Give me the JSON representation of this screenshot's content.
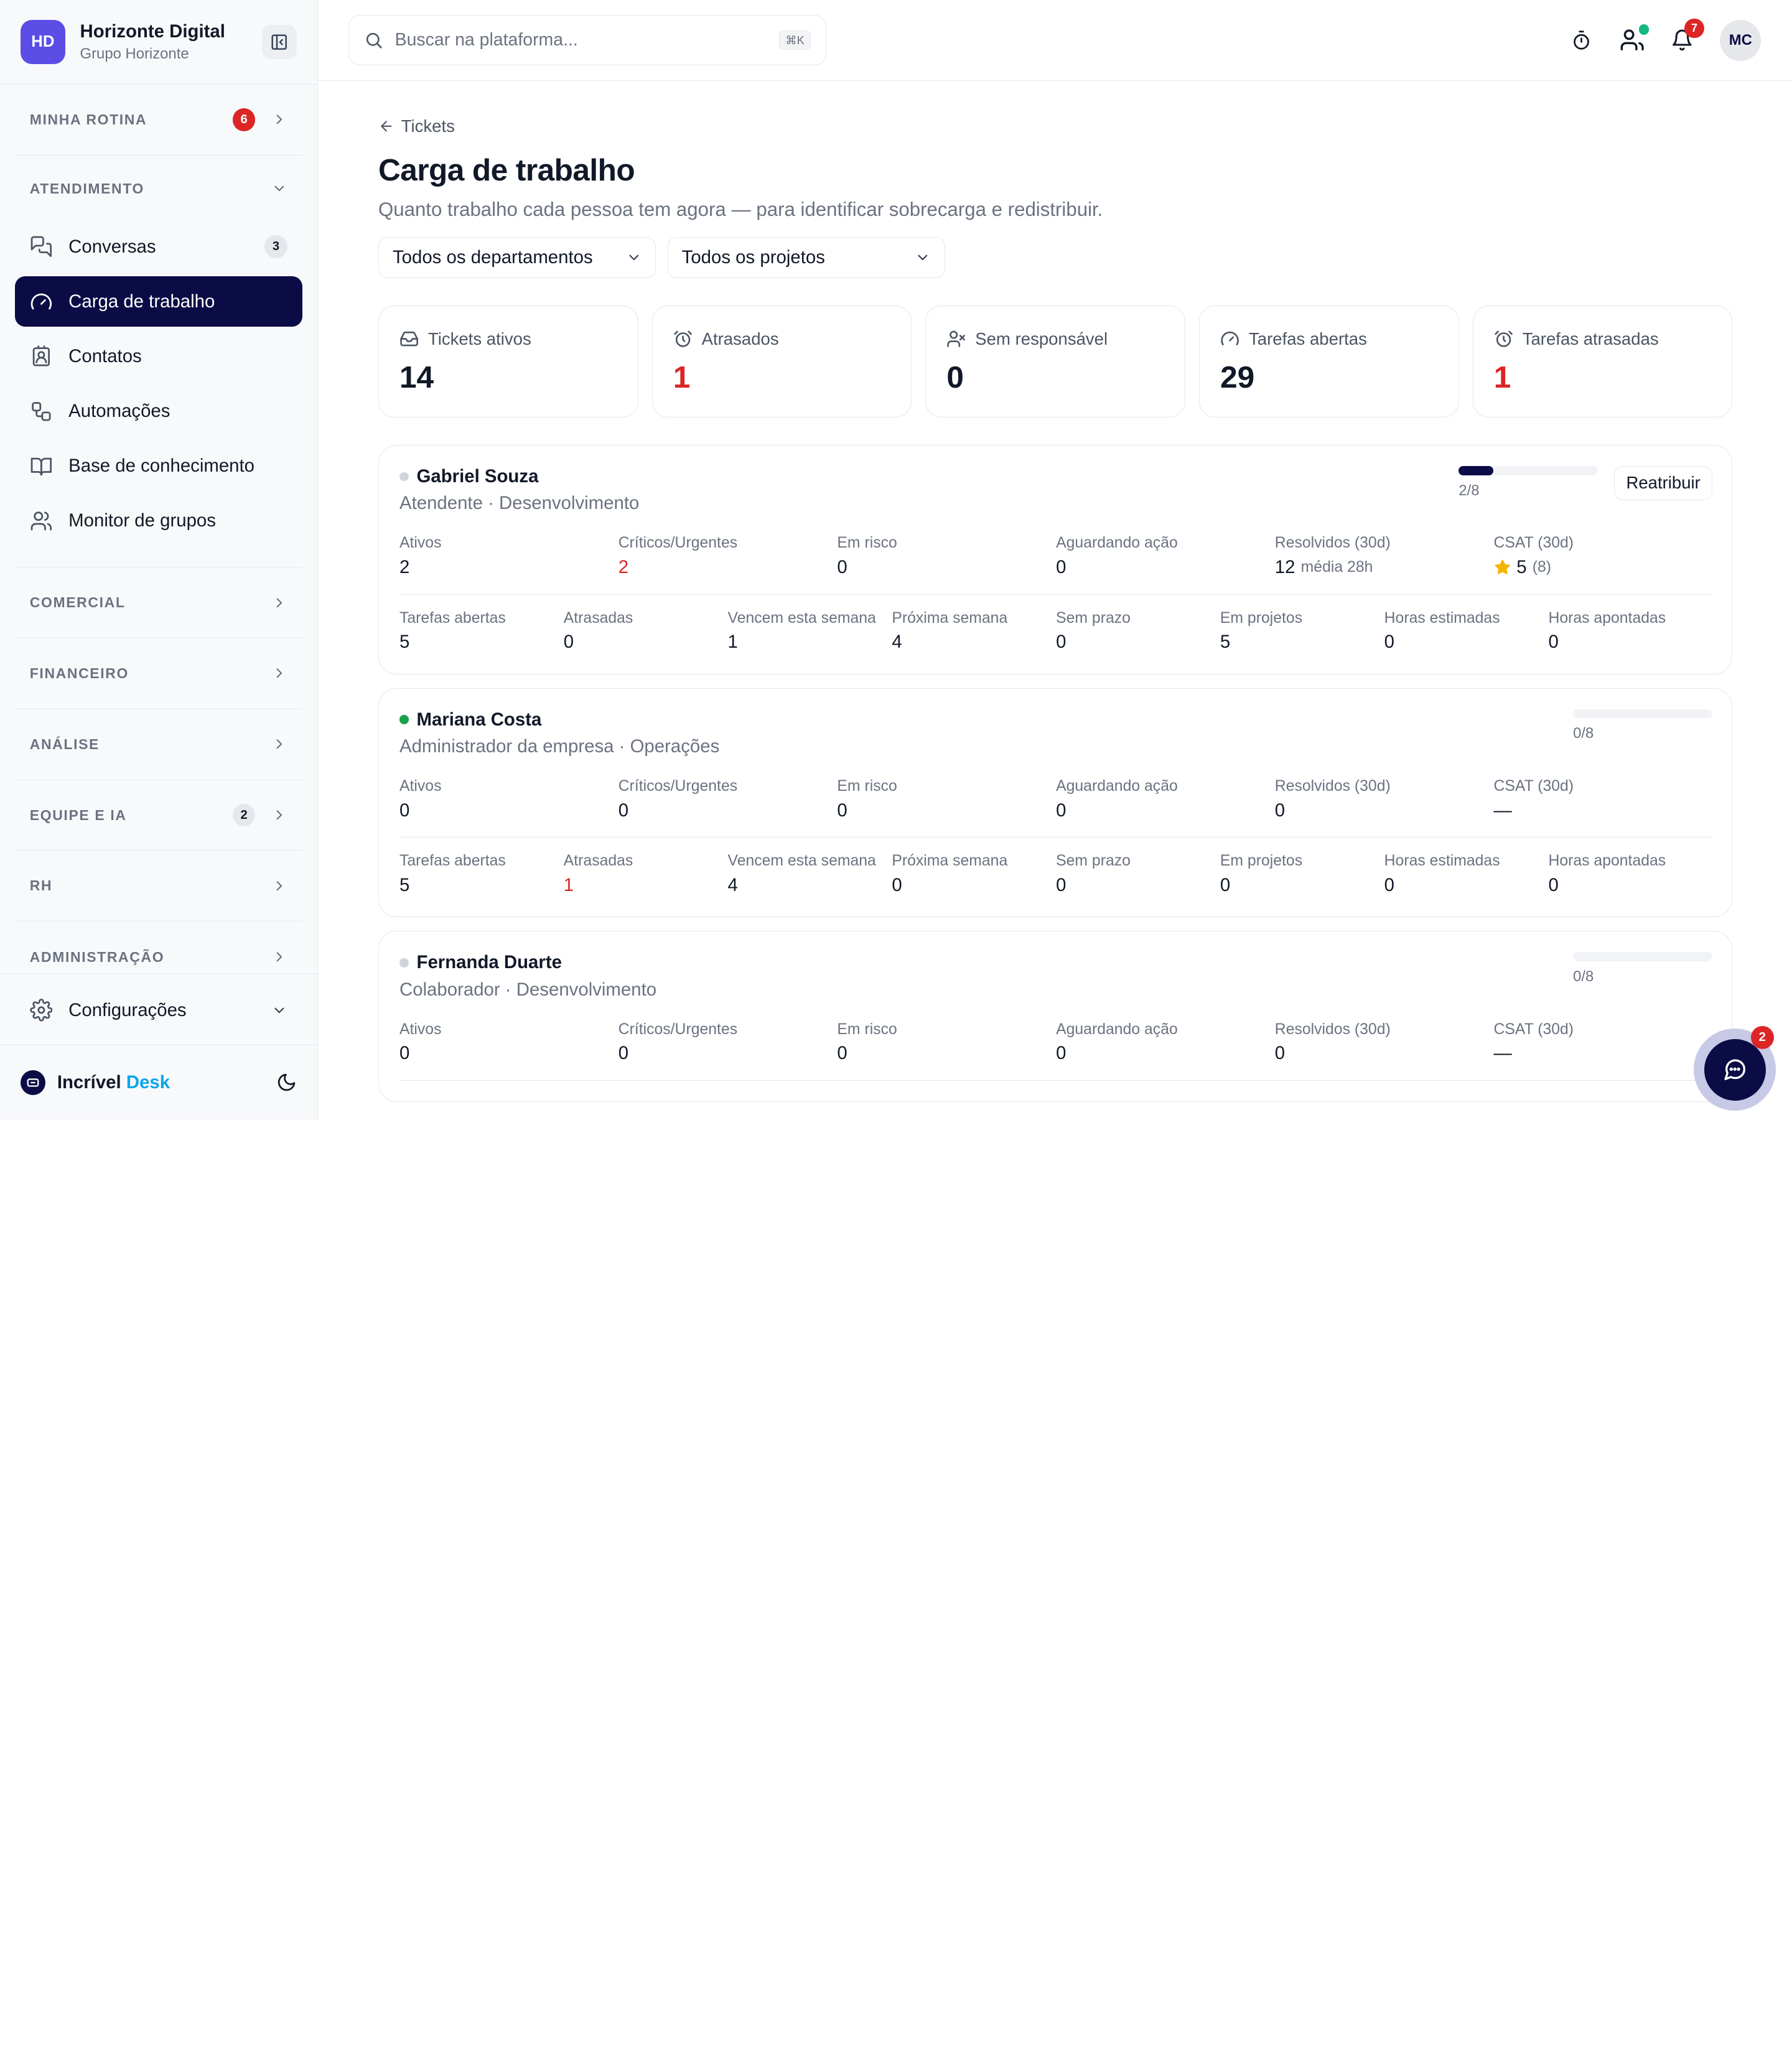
{
  "brand": {
    "initials": "HD",
    "name": "Horizonte Digital",
    "org": "Grupo Horizonte"
  },
  "sidebar": {
    "routine": {
      "label": "MINHA ROTINA",
      "badge": "6"
    },
    "atendimento": {
      "label": "ATENDIMENTO",
      "items": [
        {
          "label": "Conversas",
          "badge": "3"
        },
        {
          "label": "Carga de trabalho"
        },
        {
          "label": "Contatos"
        },
        {
          "label": "Automações"
        },
        {
          "label": "Base de conhecimento"
        },
        {
          "label": "Monitor de grupos"
        }
      ]
    },
    "sections": [
      {
        "label": "COMERCIAL"
      },
      {
        "label": "FINANCEIRO"
      },
      {
        "label": "ANÁLISE"
      },
      {
        "label": "EQUIPE E IA",
        "badge": "2"
      },
      {
        "label": "RH"
      },
      {
        "label": "ADMINISTRAÇÃO"
      }
    ],
    "settings": "Configurações",
    "footer": {
      "brand_main": "Incrível",
      "brand_accent": "Desk"
    }
  },
  "topbar": {
    "search_placeholder": "Buscar na plataforma...",
    "shortcut": "⌘K",
    "notifications": "7",
    "avatar": "MC"
  },
  "page": {
    "back_label": "Tickets",
    "title": "Carga de trabalho",
    "subtitle": "Quanto trabalho cada pessoa tem agora — para identificar sobrecarga e redistribuir.",
    "filters": {
      "department": "Todos os departamentos",
      "project": "Todos os projetos"
    }
  },
  "stats": [
    {
      "label": "Tickets ativos",
      "value": "14",
      "icon": "inbox-icon"
    },
    {
      "label": "Atrasados",
      "value": "1",
      "icon": "alarm-icon",
      "danger": true
    },
    {
      "label": "Sem responsável",
      "value": "0",
      "icon": "user-x-icon"
    },
    {
      "label": "Tarefas abertas",
      "value": "29",
      "icon": "gauge-icon"
    },
    {
      "label": "Tarefas atrasadas",
      "value": "1",
      "icon": "alarm-icon",
      "danger": true
    }
  ],
  "labels": {
    "ativos": "Ativos",
    "criticos": "Críticos/Urgentes",
    "em_risco": "Em risco",
    "aguardando": "Aguardando ação",
    "resolvidos": "Resolvidos (30d)",
    "csat": "CSAT (30d)",
    "tarefas_abertas": "Tarefas abertas",
    "atrasadas": "Atrasadas",
    "vencem": "Vencem esta semana",
    "proxima": "Próxima semana",
    "sem_prazo": "Sem prazo",
    "em_projetos": "Em projetos",
    "horas_estimadas": "Horas estimadas",
    "horas_apontadas": "Horas apontadas",
    "reassign": "Reatribuir"
  },
  "people": [
    {
      "name": "Gabriel Souza",
      "role": "Atendente · Desenvolvimento",
      "online": false,
      "load_text": "2/8",
      "load_fraction": 0.25,
      "ativos": "2",
      "criticos": "2",
      "em_risco": "0",
      "aguardando": "0",
      "resolvidos": "12",
      "resolvidos_sub": "média 28h",
      "csat": "5",
      "csat_count": "(8)",
      "tarefas_abertas": "5",
      "atrasadas": "0",
      "vencem": "1",
      "proxima": "4",
      "sem_prazo": "0",
      "em_projetos": "5",
      "horas_estimadas": "0",
      "horas_apontadas": "0"
    },
    {
      "name": "Mariana Costa",
      "role": "Administrador da empresa · Operações",
      "online": true,
      "load_text": "0/8",
      "load_fraction": 0,
      "ativos": "0",
      "criticos": "0",
      "em_risco": "0",
      "aguardando": "0",
      "resolvidos": "0",
      "csat": "—",
      "tarefas_abertas": "5",
      "atrasadas": "1",
      "vencem": "4",
      "proxima": "0",
      "sem_prazo": "0",
      "em_projetos": "0",
      "horas_estimadas": "0",
      "horas_apontadas": "0"
    },
    {
      "name": "Fernanda Duarte",
      "role": "Colaborador · Desenvolvimento",
      "online": false,
      "load_text": "0/8",
      "load_fraction": 0,
      "ativos": "0",
      "criticos": "0",
      "em_risco": "0",
      "aguardando": "0",
      "resolvidos": "0",
      "csat": "—"
    }
  ],
  "chat": {
    "badge": "2"
  },
  "colors": {
    "primary": "#0b0b45",
    "brand": "#5b4de6",
    "danger": "#dc2626",
    "online": "#16a34a",
    "star": "#f5b301"
  }
}
